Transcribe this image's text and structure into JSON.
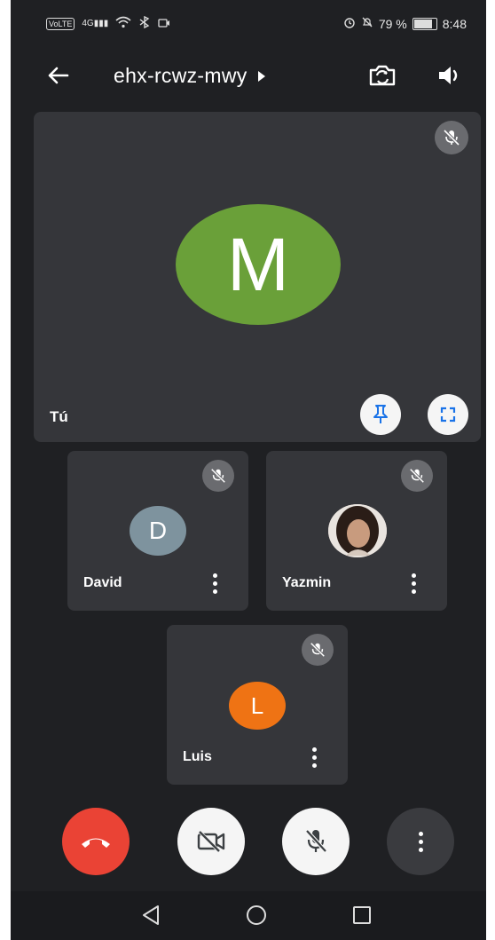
{
  "status_bar": {
    "network_label": "VoLTE",
    "signal_label": "4G",
    "battery": "79 %",
    "battery_level": 0.79,
    "time": "8:48"
  },
  "header": {
    "meeting_code": "ehx-rcwz-mwy",
    "back_icon": "arrow-left-icon",
    "switch_camera_icon": "camera-switch-icon",
    "audio_icon": "speaker-icon"
  },
  "self_tile": {
    "initial": "M",
    "label": "Tú",
    "avatar_color": "#6aa039",
    "muted": true
  },
  "participants": [
    {
      "name": "David",
      "initial": "D",
      "avatar_color": "#7e939e",
      "muted": true
    },
    {
      "name": "Yazmin",
      "initial": "",
      "avatar_color": "#c9b6a8",
      "muted": true
    },
    {
      "name": "Luis",
      "initial": "L",
      "avatar_color": "#ef7314",
      "muted": true
    }
  ],
  "controls": {
    "end_call_color": "#ea4335",
    "camera_state": "off",
    "mic_state": "off"
  },
  "colors": {
    "background": "#1f2023",
    "tile": "#35363a",
    "mute_badge": "#6a6b6f"
  }
}
